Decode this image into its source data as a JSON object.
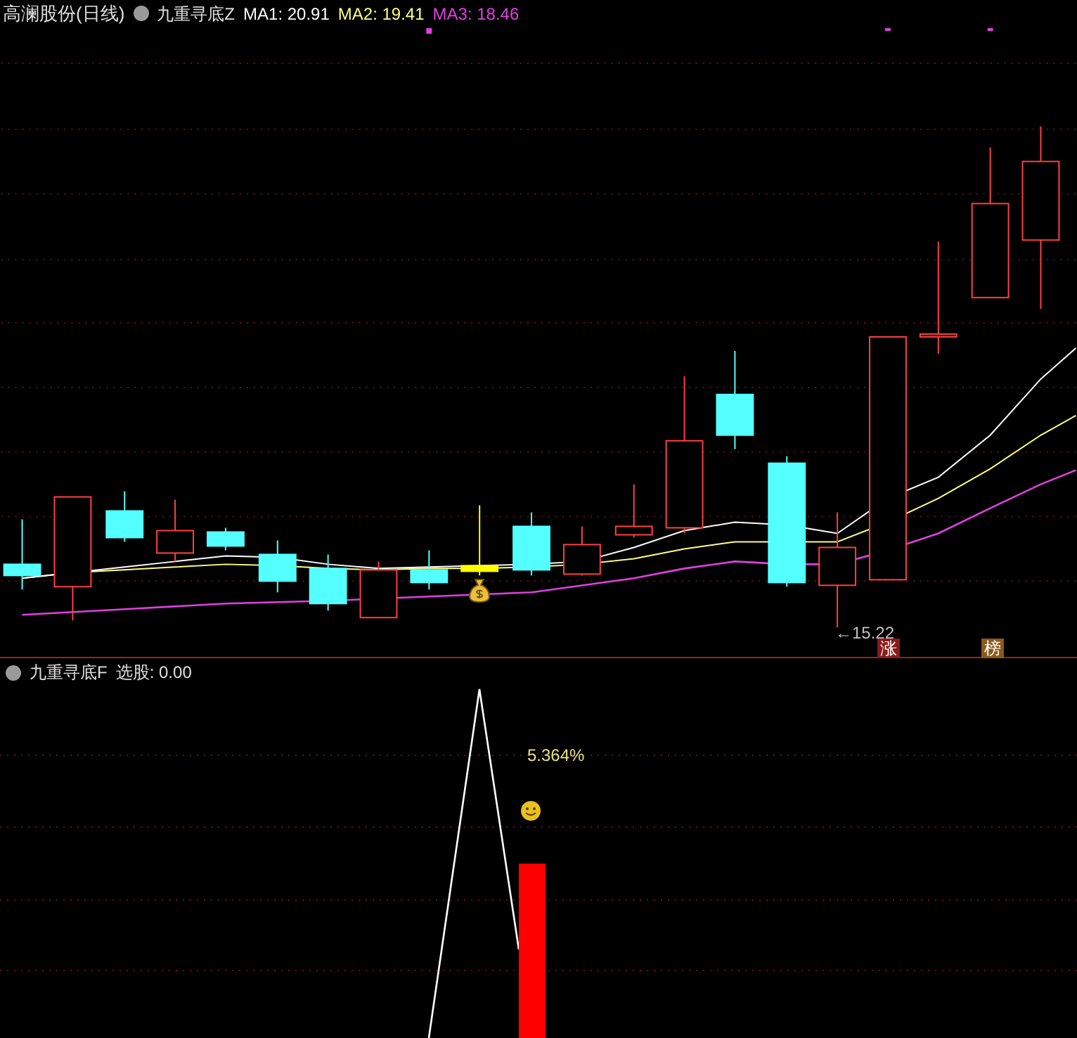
{
  "top_panel": {
    "stock_title": "高澜股份(日线)",
    "indicator": "九重寻底Z",
    "ma_values": [
      {
        "label": "MA1: 20.91",
        "color": "#ffffff"
      },
      {
        "label": "MA2: 19.41",
        "color": "#ffff80"
      },
      {
        "label": "MA3: 18.46",
        "color": "#e040e0"
      }
    ],
    "low_price_label": "←15.22",
    "badges": [
      {
        "text": "涨",
        "color": "#8b1a1a"
      },
      {
        "text": "榜",
        "color": "#8b5a1a"
      }
    ]
  },
  "bottom_panel": {
    "indicator": "九重寻底F",
    "value_label": "选股: 0.00",
    "percent_label": "5.364%"
  }
}
